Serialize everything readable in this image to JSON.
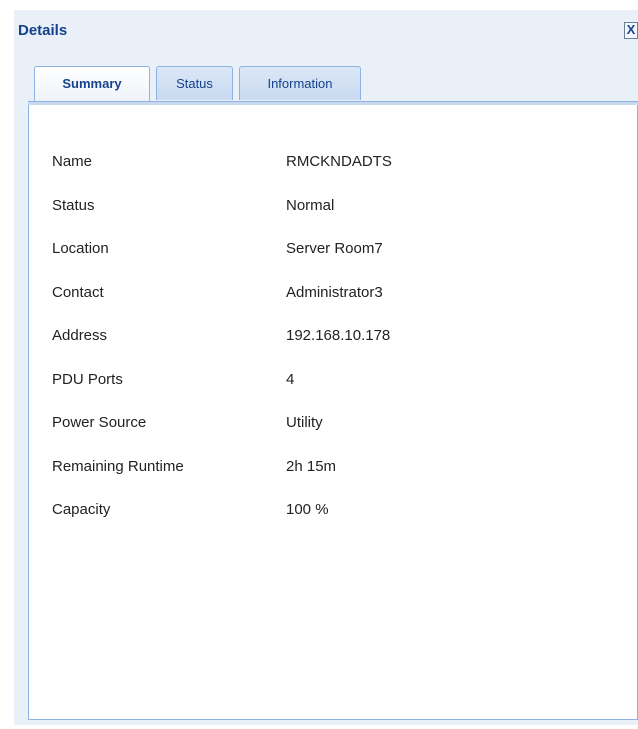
{
  "window": {
    "title": "Details",
    "close_label": "X"
  },
  "tabs": [
    {
      "label": "Summary",
      "active": true
    },
    {
      "label": "Status",
      "active": false
    },
    {
      "label": "Information",
      "active": false
    }
  ],
  "details": [
    {
      "label": "Name",
      "value": "RMCKNDADTS"
    },
    {
      "label": "Status",
      "value": "Normal"
    },
    {
      "label": "Location",
      "value": "Server Room7"
    },
    {
      "label": "Contact",
      "value": "Administrator3"
    },
    {
      "label": "Address",
      "value": "192.168.10.178"
    },
    {
      "label": "PDU Ports",
      "value": "4"
    },
    {
      "label": "Power Source",
      "value": "Utility"
    },
    {
      "label": "Remaining Runtime",
      "value": "2h 15m"
    },
    {
      "label": "Capacity",
      "value": "100 %"
    }
  ]
}
